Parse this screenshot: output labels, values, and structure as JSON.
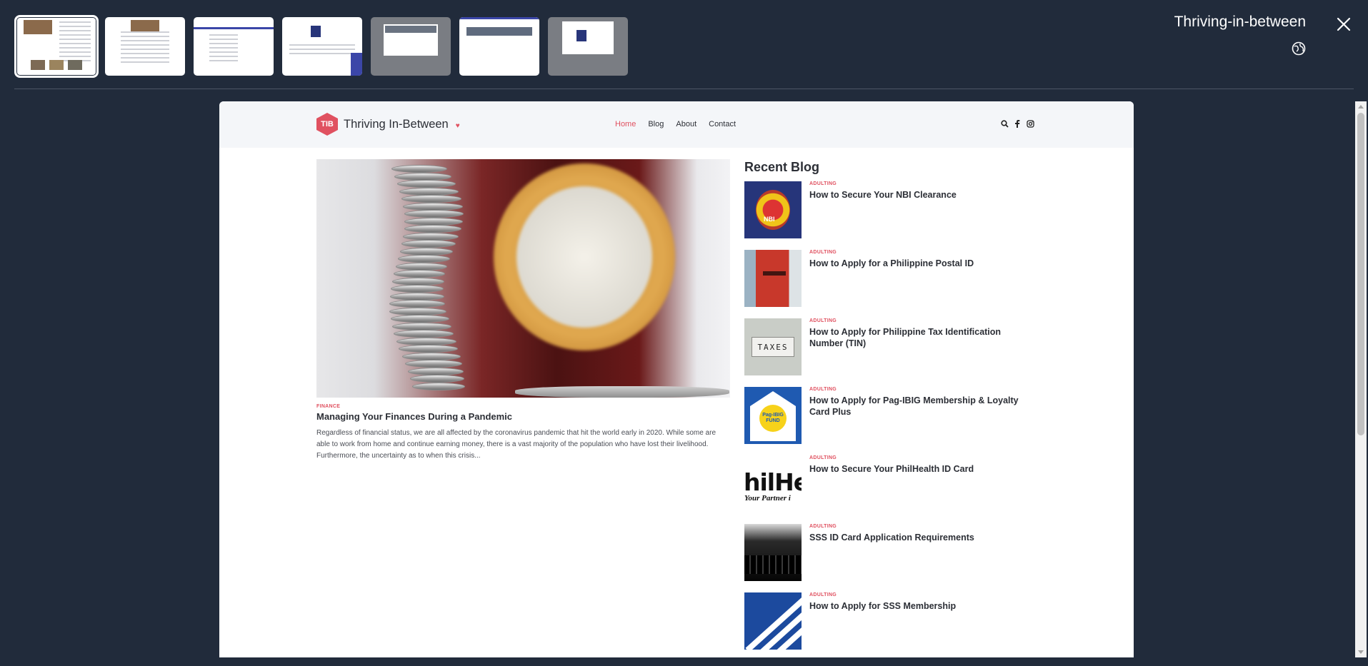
{
  "viewer": {
    "title": "Thriving-in-between",
    "thumbnail_count": 7,
    "selected_thumbnail": 1,
    "close_icon": "close-icon",
    "globe_icon": "globe-icon"
  },
  "site": {
    "logo_badge": "TIB",
    "logo_text": "Thriving In-Between",
    "accent_color": "#e05160",
    "nav": [
      {
        "label": "Home",
        "active": true
      },
      {
        "label": "Blog",
        "active": false
      },
      {
        "label": "About",
        "active": false
      },
      {
        "label": "Contact",
        "active": false
      }
    ],
    "header_icons": [
      "search-icon",
      "facebook-icon",
      "instagram-icon"
    ]
  },
  "feature": {
    "category": "FINANCE",
    "title": "Managing Your Finances During a Pandemic",
    "excerpt": "Regardless of financial status, we are all affected by the coronavirus pandemic that hit the world early in 2020. While some are able to work from home and continue earning money, there is a vast majority of the population who have lost their livelihood. Furthermore, the uncertainty as to when this crisis..."
  },
  "recent": {
    "heading": "Recent Blog",
    "posts": [
      {
        "category": "ADULTING",
        "title": "How to Secure Your NBI Clearance",
        "thumb_text": "NBI"
      },
      {
        "category": "ADULTING",
        "title": "How to Apply for a Philippine Postal ID"
      },
      {
        "category": "ADULTING",
        "title": "How to Apply for Philippine Tax Identification Number (TIN)",
        "thumb_text": "TAXES"
      },
      {
        "category": "ADULTING",
        "title": "How to Apply for Pag-IBIG Membership & Loyalty Card Plus",
        "thumb_text": "Pag-IBIG FUND"
      },
      {
        "category": "ADULTING",
        "title": "How to Secure Your PhilHealth ID Card",
        "thumb_text": "hilHe",
        "thumb_text_2": "Your Partner i"
      },
      {
        "category": "ADULTING",
        "title": "SSS ID Card Application Requirements"
      },
      {
        "category": "ADULTING",
        "title": "How to Apply for SSS Membership"
      }
    ]
  }
}
